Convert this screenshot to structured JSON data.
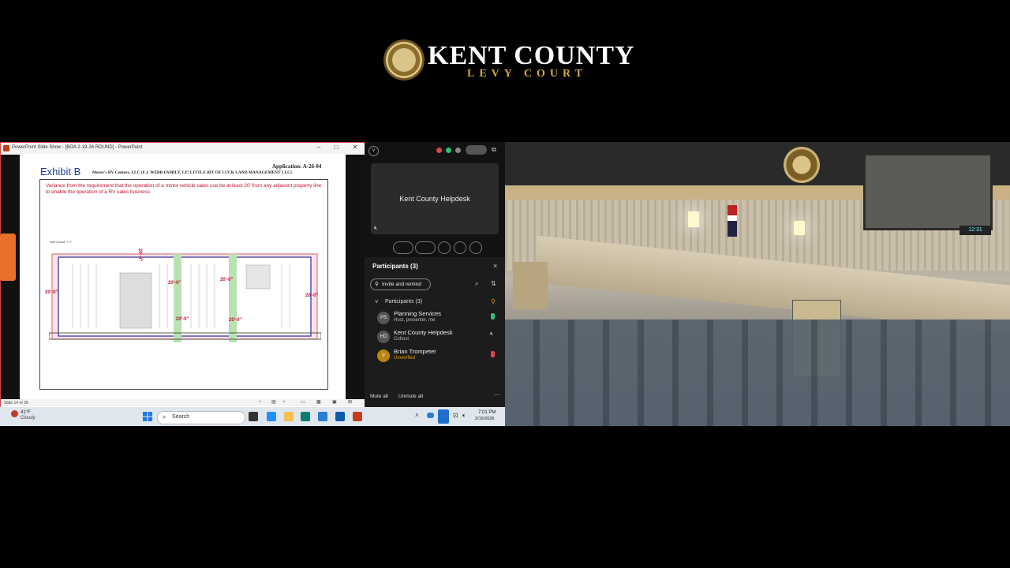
{
  "brand": {
    "title": "KENT COUNTY",
    "subtitle": "LEVY COURT"
  },
  "ppt": {
    "window_title": "PowerPoint Slide Show - [BOA 2-19-26 ROUND] - PowerPoint",
    "slide_counter": "Slide 14 of 39",
    "slide": {
      "exhibit": "Exhibit B",
      "application": "Application: A-26-04",
      "owners": "Meyer's RV Centers, LLC (F.J. WEBB FAMILY, LP; LITTLE BIT OF LUCK LAND MANAGEMENT LLC)",
      "variance": "Variance from the requirement that the operation of a motor vehicle sales use be at least 20' from any adjacent property line to enable the operation of a RV sales business",
      "plan_label": "Unit Count: ???",
      "dimensions": [
        "20'-0\"",
        "20'-0\"",
        "20'-0\"",
        "20'-0\"",
        "20'-0\"",
        "20'-0\"",
        "20'-0\""
      ]
    }
  },
  "taskbar": {
    "temp": "41°F",
    "condition": "Cloudy",
    "search": "Search",
    "time": "7:01 PM",
    "date": "2/19/2026"
  },
  "webex": {
    "tile_name": "Kent County Helpdesk",
    "participants_title": "Participants (3)",
    "invite": "Invite and remind",
    "group": "Participants (3)",
    "participants": [
      {
        "initials": "PS",
        "name": "Planning Services",
        "role": "Host, presenter, me"
      },
      {
        "initials": "HD",
        "name": "Kent County Helpdesk",
        "role": "Cohost"
      },
      {
        "initials": "",
        "name": "Brian Trompeter",
        "role": "Unverified"
      }
    ],
    "mute_all": "Mute all",
    "unmute_all": "Unmute all",
    "colors": {
      "unverified": "#e0a000",
      "accent": "#2b7cd3"
    }
  },
  "room": {
    "clock": "12:31"
  }
}
